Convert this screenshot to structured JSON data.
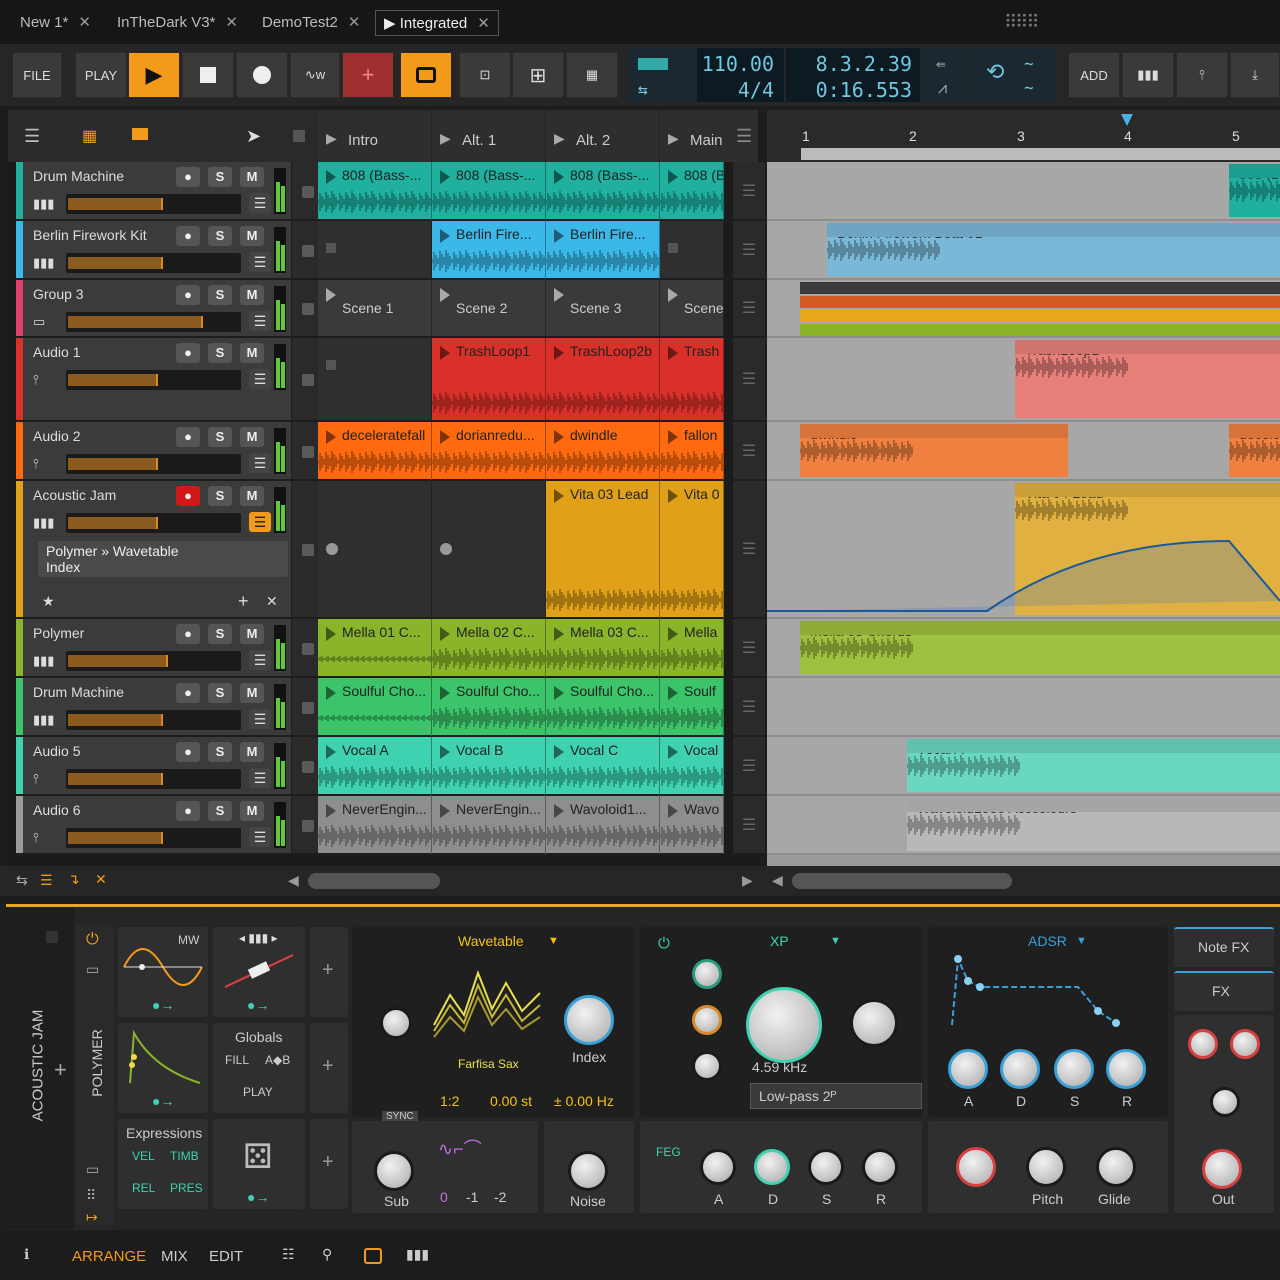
{
  "tabs": [
    {
      "label": "New 1*"
    },
    {
      "label": "InTheDark V3*"
    },
    {
      "label": "DemoTest2"
    },
    {
      "label": "Integrated"
    }
  ],
  "toolbar": {
    "file": "FILE",
    "play": "PLAY",
    "add": "ADD",
    "tempo": "110.00",
    "signature": "4/4",
    "position": "8.3.2.39",
    "time": "0:16.553"
  },
  "scenes": {
    "headers": [
      "Intro",
      "Alt. 1",
      "Alt. 2",
      "Main"
    ]
  },
  "tracks": [
    {
      "name": "Drum Machine",
      "color": "#1fb0a0",
      "clips": [
        "808 (Bass-...",
        "808 (Bass-...",
        "808 (Bass-...",
        "808 (B"
      ]
    },
    {
      "name": "Berlin Firework Kit",
      "color": "#3ab8e8",
      "clips": [
        "",
        "Berlin Fire...",
        "Berlin Fire...",
        ""
      ]
    },
    {
      "name": "Group 3",
      "color": "#e0406a",
      "clips": [
        "Scene 1",
        "Scene 2",
        "Scene 3",
        "Scene"
      ]
    },
    {
      "name": "Audio 1",
      "color": "#d9302a",
      "clips": [
        "",
        "TrashLoop1",
        "TrashLoop2b",
        "Trash"
      ]
    },
    {
      "name": "Audio 2",
      "color": "#ff6a10",
      "clips": [
        "deceleratefall",
        "dorianredu...",
        "dwindle",
        "fallon"
      ]
    },
    {
      "name": "Acoustic Jam",
      "color": "#e0a018",
      "clips": [
        "",
        "",
        "Vita 03 Lead",
        "Vita 0"
      ]
    },
    {
      "name": "Polymer",
      "color": "#8ab42a",
      "clips": [
        "Mella 01 C...",
        "Mella 02 C...",
        "Mella 03 C...",
        "Mella"
      ]
    },
    {
      "name": "Drum Machine",
      "color": "#3cc46a",
      "clips": [
        "Soulful Cho...",
        "Soulful Cho...",
        "Soulful Cho...",
        "Soulf"
      ]
    },
    {
      "name": "Audio 5",
      "color": "#3ed2b0",
      "clips": [
        "Vocal A",
        "Vocal B",
        "Vocal C",
        "Vocal"
      ]
    },
    {
      "name": "Audio 6",
      "color": "#9a9a9a",
      "clips": [
        "NeverEngin...",
        "NeverEngin...",
        "Wavoloid1...",
        "Wavo"
      ]
    }
  ],
  "param": {
    "line1": "Polymer » Wavetable",
    "line2": "Index"
  },
  "ruler": [
    "1",
    "2",
    "3",
    "4",
    "5"
  ],
  "arrange": {
    "c1": "808 (B",
    "c2": "Berlin Firework Beat 01",
    "c3": "TrashLoop1",
    "c4": "dwindle",
    "c5": "decele",
    "c6": "Vita 04 Lead",
    "c7": "Mella 03 Chords",
    "c8": "Vocal A",
    "c9": "Wavoloid1955 Acccolours"
  },
  "device": {
    "side": "ACOUSTIC JAM",
    "name": "POLYMER",
    "mw": "MW",
    "globals": "Globals",
    "fill": "FILL",
    "ab": "A◆B",
    "playm": "PLAY",
    "expressions": "Expressions",
    "vel": "VEL",
    "timb": "TIMB",
    "rel": "REL",
    "pres": "PRES",
    "wt": "Wavetable",
    "wtname": "Farfisa Sax",
    "index": "Index",
    "ratio": "1:2",
    "st": "0.00 st",
    "hz": "± 0.00 Hz",
    "sync": "SYNC",
    "sub": "Sub",
    "o0": "0",
    "o1": "-1",
    "o2": "-2",
    "noise": "Noise",
    "xp": "XP",
    "freq": "4.59 kHz",
    "filter": "Low-pass 2ᴾ",
    "feg": "FEG",
    "adsr": "ADSR",
    "a": "A",
    "d": "D",
    "s": "S",
    "r": "R",
    "notefx": "Note FX",
    "fx": "FX",
    "pitch": "Pitch",
    "glide": "Glide",
    "out": "Out"
  },
  "bottom": {
    "arrange": "ARRANGE",
    "mix": "MIX",
    "edit": "EDIT"
  }
}
